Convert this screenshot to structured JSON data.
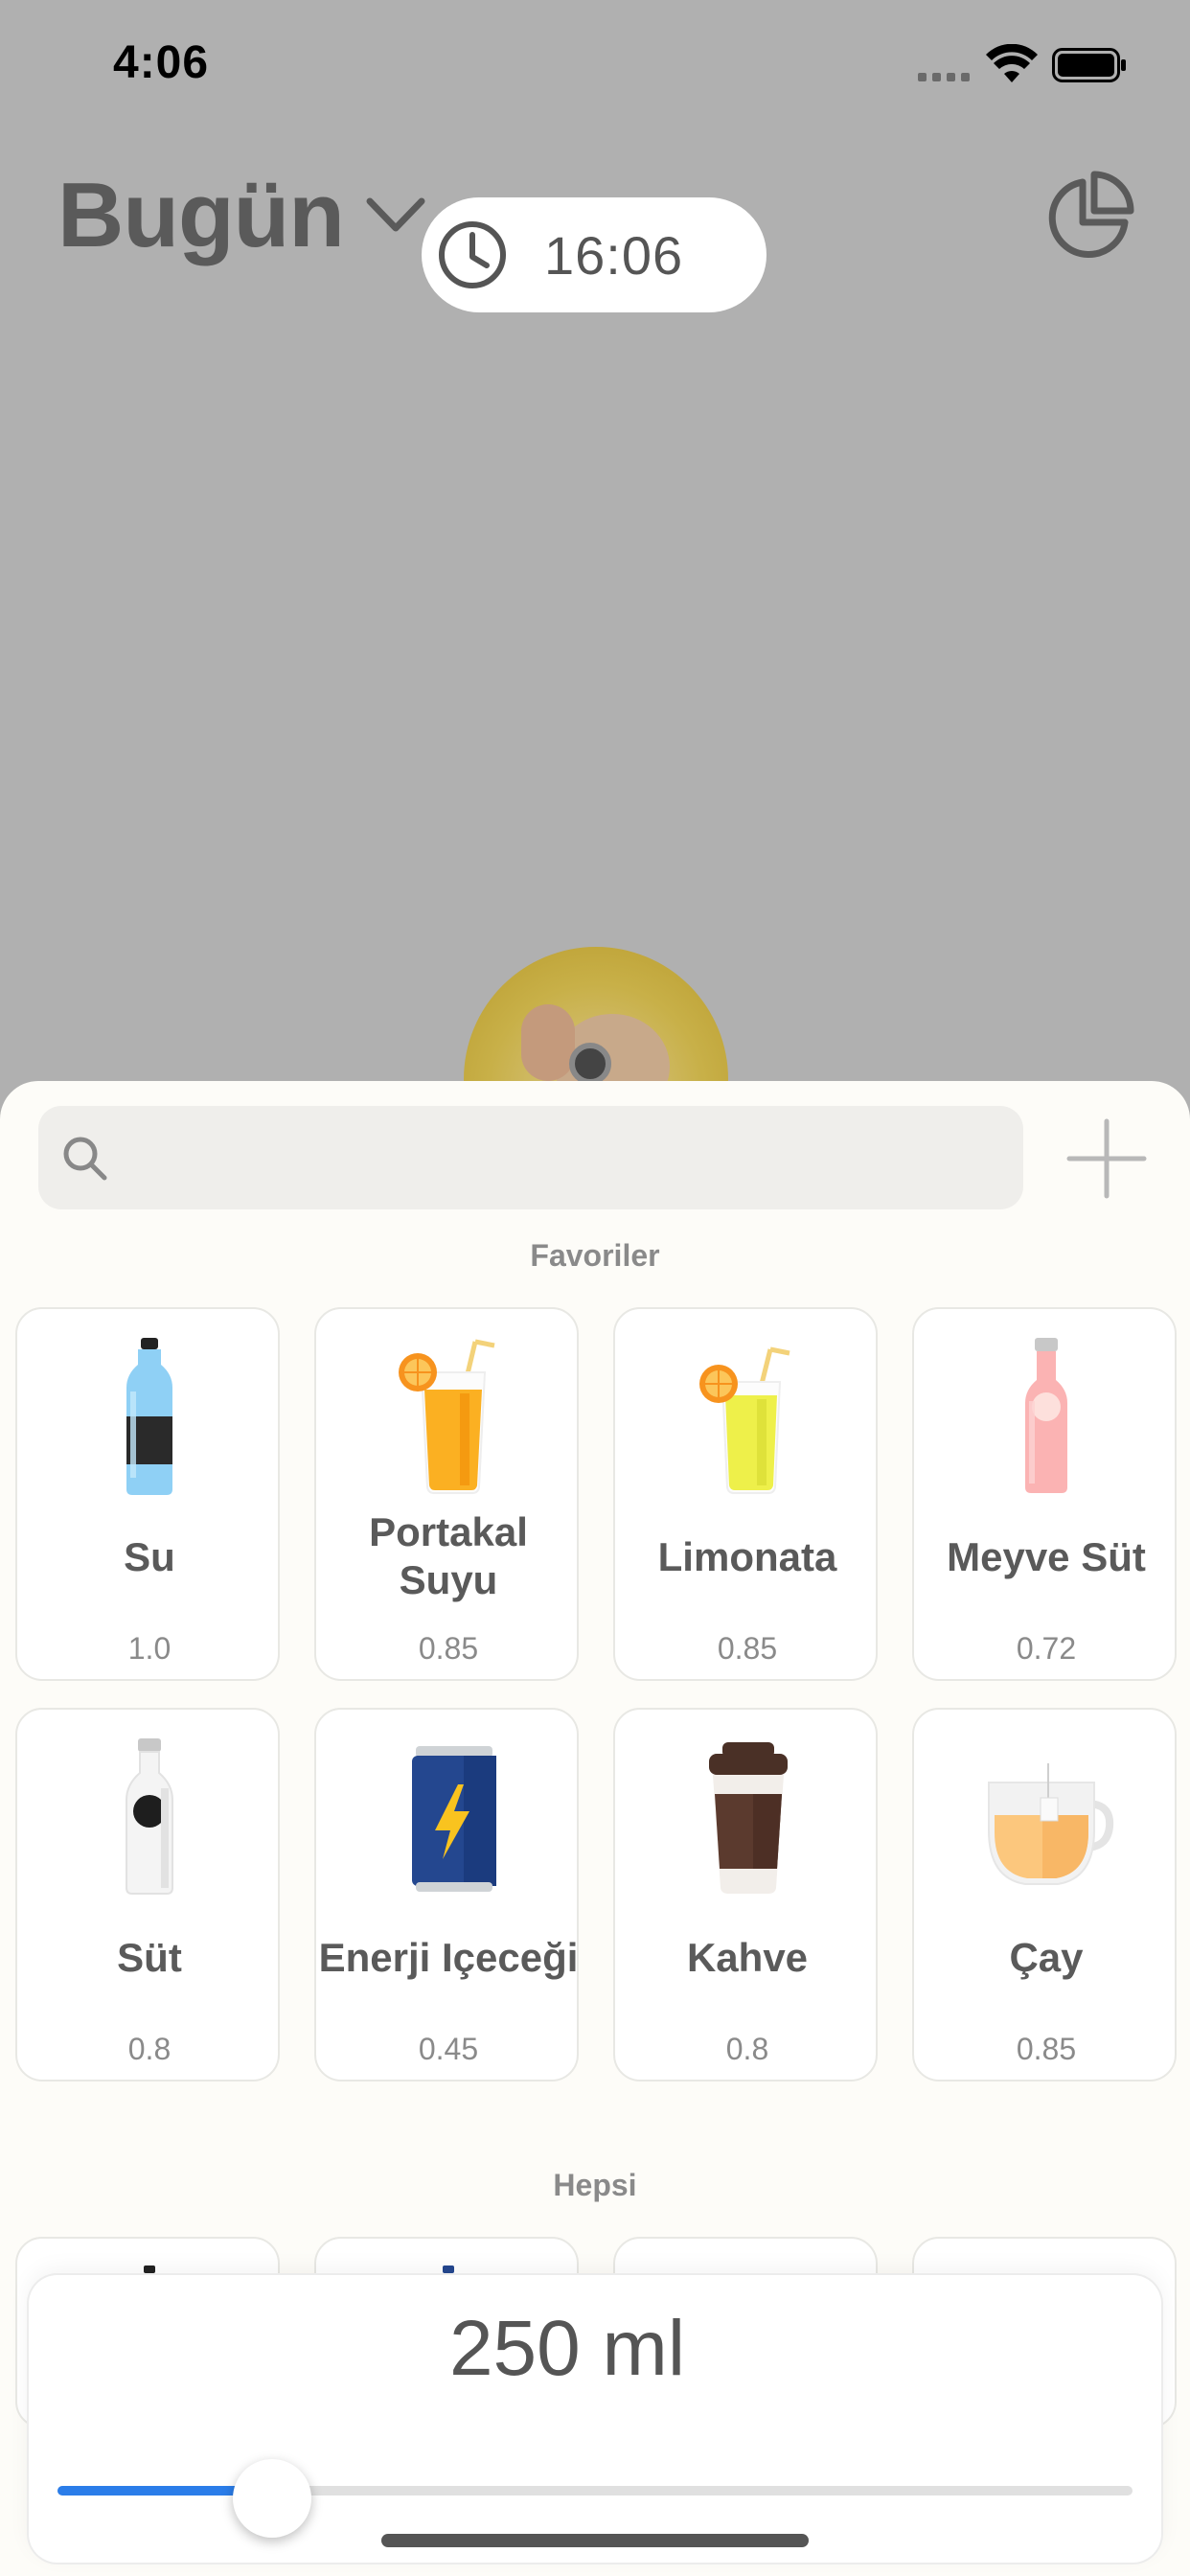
{
  "status_bar": {
    "time": "4:06"
  },
  "header": {
    "title": "Bugün",
    "chevron_icon": "chevron-down-icon",
    "stats_icon": "pie-chart-icon",
    "time_picker": {
      "icon": "clock-icon",
      "value": "16:06"
    }
  },
  "sheet": {
    "search": {
      "placeholder": "",
      "value": "",
      "icon": "search-icon"
    },
    "add_icon": "plus-icon",
    "favorites_label": "Favoriler",
    "all_label": "Hepsi",
    "favorites": [
      {
        "name": "Su",
        "value": "1.0",
        "icon": "water-bottle-icon"
      },
      {
        "name": "Portakal Suyu",
        "value": "0.85",
        "icon": "orange-juice-icon"
      },
      {
        "name": "Limonata",
        "value": "0.85",
        "icon": "lemonade-icon"
      },
      {
        "name": "Meyve Süt",
        "value": "0.72",
        "icon": "fruit-milk-icon"
      },
      {
        "name": "Süt",
        "value": "0.8",
        "icon": "milk-bottle-icon"
      },
      {
        "name": "Enerji Içeceği",
        "value": "0.45",
        "icon": "energy-drink-icon"
      },
      {
        "name": "Kahve",
        "value": "0.8",
        "icon": "coffee-cup-icon"
      },
      {
        "name": "Çay",
        "value": "0.85",
        "icon": "tea-cup-icon"
      }
    ]
  },
  "volume": {
    "amount": "250 ml",
    "slider_fraction": 0.2
  },
  "colors": {
    "accent": "#2b7de9",
    "overlay": "#b0b0b0",
    "sheet_bg": "#fdfcf8"
  }
}
